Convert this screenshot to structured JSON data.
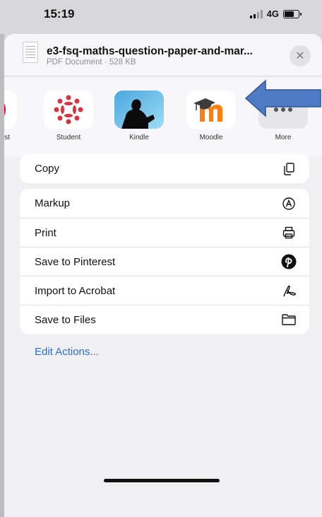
{
  "status_bar": {
    "time": "15:19",
    "network": "4G"
  },
  "file": {
    "title": "e3-fsq-maths-question-paper-and-mar...",
    "subtitle": "PDF Document · 528 KB"
  },
  "apps": [
    {
      "label": "est",
      "icon": "pinterest-icon"
    },
    {
      "label": "Student",
      "icon": "student-app-icon"
    },
    {
      "label": "Kindle",
      "icon": "kindle-icon"
    },
    {
      "label": "Moodle",
      "icon": "moodle-icon"
    },
    {
      "label": "More",
      "icon": "more-icon"
    }
  ],
  "actions": {
    "group1": [
      {
        "label": "Copy",
        "icon": "copy-icon"
      }
    ],
    "group2": [
      {
        "label": "Markup",
        "icon": "markup-icon"
      },
      {
        "label": "Print",
        "icon": "print-icon"
      },
      {
        "label": "Save to Pinterest",
        "icon": "pinterest-icon"
      },
      {
        "label": "Import to Acrobat",
        "icon": "acrobat-icon"
      },
      {
        "label": "Save to Files",
        "icon": "folder-icon"
      }
    ]
  },
  "edit_actions_label": "Edit Actions...",
  "colors": {
    "arrow": "#4f7bc4",
    "accent_link": "#2a6fd6",
    "moodle_orange": "#f98012",
    "pinterest_red": "#e60023"
  }
}
